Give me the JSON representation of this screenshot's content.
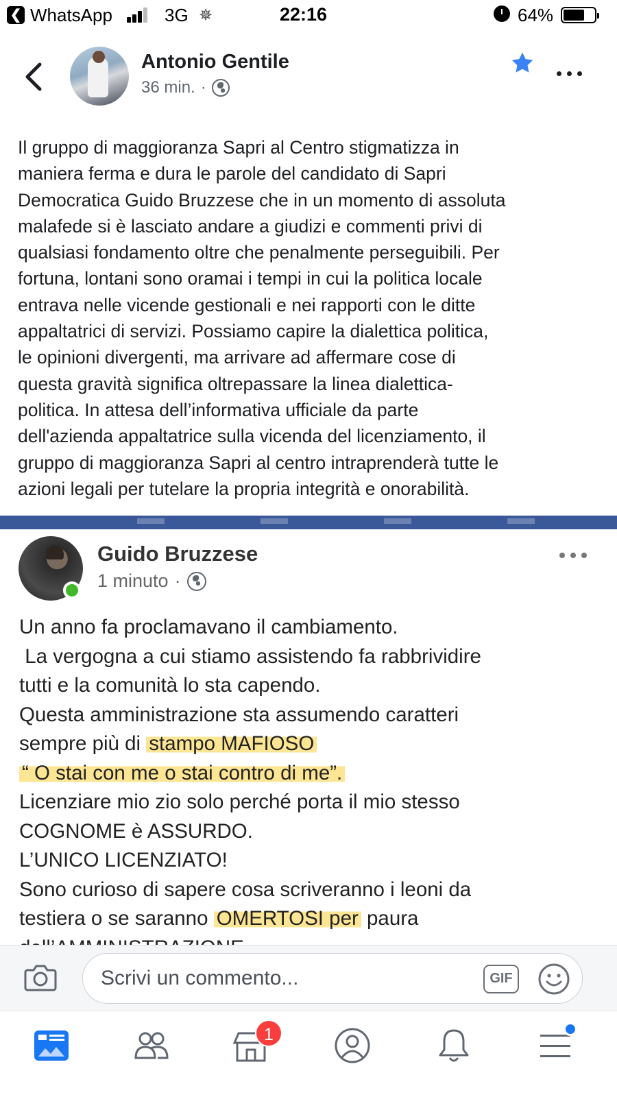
{
  "status_bar": {
    "back_app": "WhatsApp",
    "network": "3G",
    "time": "22:16",
    "battery": "64%"
  },
  "post": {
    "author": "Antonio Gentile",
    "time": "36 min.",
    "separator": "·",
    "body_lines": [
      "Il gruppo di maggioranza Sapri al Centro stigmatizza in",
      "maniera ferma e dura le parole del candidato di Sapri",
      "Democratica Guido Bruzzese che in un momento di assoluta",
      "malafede si è lasciato andare a giudizi e commenti privi di",
      "qualsiasi fondamento oltre che penalmente perseguibili. Per",
      "fortuna, lontani sono oramai i tempi in cui la politica locale",
      "entrava nelle vicende gestionali e nei rapporti con le ditte",
      "appaltatrici di servizi. Possiamo capire la dialettica politica,",
      "le opinioni divergenti, ma arrivare ad affermare cose di",
      "questa gravità significa oltrepassare la linea dialettica-",
      "politica. In attesa dell’informativa ufficiale da parte",
      "dell'azienda appaltatrice sulla vicenda del licenziamento, il",
      "gruppo di maggioranza Sapri al centro intraprenderà tutte le",
      "azioni legali per tutelare la propria integrità e onorabilità."
    ]
  },
  "embedded": {
    "author": "Guido Bruzzese",
    "time": "1 minuto",
    "separator": "·",
    "lines": {
      "l1": "Un anno fa proclamavano il cambiamento.",
      "l2": " La vergogna a cui stiamo assistendo fa rabbrividire",
      "l3": "tutti e la comunità lo sta capendo.",
      "l4": "Questa amministrazione sta assumendo caratteri",
      "l5a": "sempre più di ",
      "l5b": "stampo MAFIOSO",
      "l6": "“ O stai con me o stai contro di me”.",
      "l7": "Licenziare mio zio solo perché porta il mio stesso",
      "l8": "COGNOME è ASSURDO.",
      "l9": "L’UNICO LICENZIATO!",
      "l10": "Sono curioso di sapere cosa scriveranno i leoni da",
      "l11a": "testiera o se saranno ",
      "l11b": "OMERTOSI per",
      "l11c": " paura",
      "l12": "dell’AMMINISTRAZIONE"
    },
    "highlight_color": "#fce282"
  },
  "comment_bar": {
    "placeholder": "Scrivi un commento...",
    "gif_label": "GIF"
  },
  "tab_bar": {
    "items": [
      "news-feed-icon",
      "friends-icon",
      "marketplace-icon",
      "profile-icon",
      "notifications-icon",
      "menu-icon"
    ],
    "marketplace_badge": "1"
  },
  "colors": {
    "accent": "#1877f2",
    "star": "#3b82f6",
    "badge": "#fa3e3e",
    "online": "#42b72a"
  }
}
